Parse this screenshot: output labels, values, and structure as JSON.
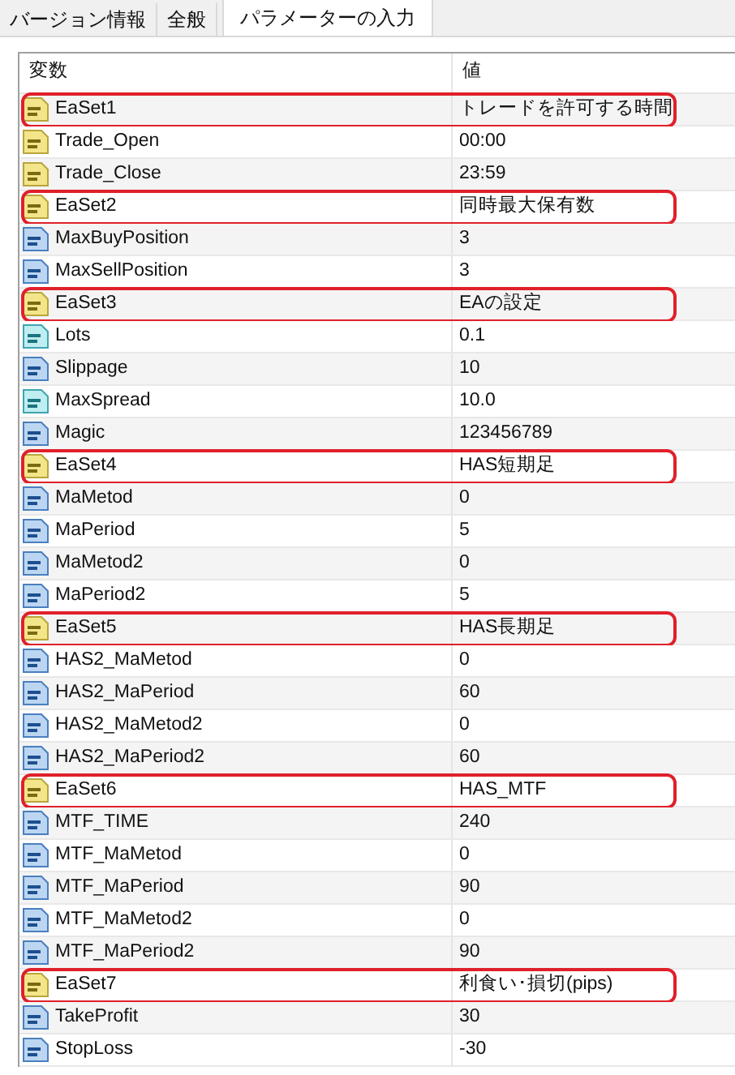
{
  "tabs": [
    {
      "label": "バージョン情報",
      "selected": false
    },
    {
      "label": "全般",
      "selected": false
    },
    {
      "label": "パラメーターの入力",
      "selected": true
    }
  ],
  "table": {
    "columns": [
      "変数",
      "値"
    ],
    "rows": [
      {
        "kind": "string",
        "name": "EaSet1",
        "value": "トレードを許可する時間",
        "highlighted": true
      },
      {
        "kind": "string",
        "name": "Trade_Open",
        "value": "00:00",
        "highlighted": false
      },
      {
        "kind": "string",
        "name": "Trade_Close",
        "value": "23:59",
        "highlighted": false
      },
      {
        "kind": "string",
        "name": "EaSet2",
        "value": "同時最大保有数",
        "highlighted": true
      },
      {
        "kind": "int",
        "name": "MaxBuyPosition",
        "value": "3",
        "highlighted": false
      },
      {
        "kind": "int",
        "name": "MaxSellPosition",
        "value": "3",
        "highlighted": false
      },
      {
        "kind": "string",
        "name": "EaSet3",
        "value": "EAの設定",
        "highlighted": true
      },
      {
        "kind": "double",
        "name": "Lots",
        "value": "0.1",
        "highlighted": false
      },
      {
        "kind": "int",
        "name": "Slippage",
        "value": "10",
        "highlighted": false
      },
      {
        "kind": "double",
        "name": "MaxSpread",
        "value": "10.0",
        "highlighted": false
      },
      {
        "kind": "int",
        "name": "Magic",
        "value": "123456789",
        "highlighted": false
      },
      {
        "kind": "string",
        "name": "EaSet4",
        "value": "HAS短期足",
        "highlighted": true
      },
      {
        "kind": "int",
        "name": "MaMetod",
        "value": "0",
        "highlighted": false
      },
      {
        "kind": "int",
        "name": "MaPeriod",
        "value": "5",
        "highlighted": false
      },
      {
        "kind": "int",
        "name": "MaMetod2",
        "value": "0",
        "highlighted": false
      },
      {
        "kind": "int",
        "name": "MaPeriod2",
        "value": "5",
        "highlighted": false
      },
      {
        "kind": "string",
        "name": "EaSet5",
        "value": "HAS長期足",
        "highlighted": true
      },
      {
        "kind": "int",
        "name": "HAS2_MaMetod",
        "value": "0",
        "highlighted": false
      },
      {
        "kind": "int",
        "name": "HAS2_MaPeriod",
        "value": "60",
        "highlighted": false
      },
      {
        "kind": "int",
        "name": "HAS2_MaMetod2",
        "value": "0",
        "highlighted": false
      },
      {
        "kind": "int",
        "name": "HAS2_MaPeriod2",
        "value": "60",
        "highlighted": false
      },
      {
        "kind": "string",
        "name": "EaSet6",
        "value": "HAS_MTF",
        "highlighted": true
      },
      {
        "kind": "int",
        "name": "MTF_TIME",
        "value": "240",
        "highlighted": false
      },
      {
        "kind": "int",
        "name": "MTF_MaMetod",
        "value": "0",
        "highlighted": false
      },
      {
        "kind": "int",
        "name": "MTF_MaPeriod",
        "value": "90",
        "highlighted": false
      },
      {
        "kind": "int",
        "name": "MTF_MaMetod2",
        "value": "0",
        "highlighted": false
      },
      {
        "kind": "int",
        "name": "MTF_MaPeriod2",
        "value": "90",
        "highlighted": false
      },
      {
        "kind": "string",
        "name": "EaSet7",
        "value": "利食い･損切(pips)",
        "highlighted": true
      },
      {
        "kind": "int",
        "name": "TakeProfit",
        "value": "30",
        "highlighted": false
      },
      {
        "kind": "int",
        "name": "StopLoss",
        "value": "-30",
        "highlighted": false
      }
    ]
  }
}
